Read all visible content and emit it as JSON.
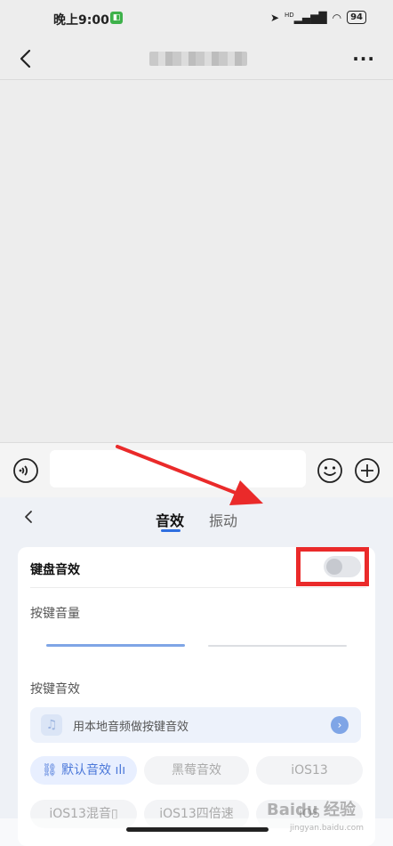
{
  "status_bar": {
    "time": "晚上9:00",
    "signal_label": "HD",
    "battery": "94"
  },
  "input_bar": {
    "placeholder": ""
  },
  "panel": {
    "tabs": [
      {
        "label": "音效",
        "active": true
      },
      {
        "label": "振动",
        "active": false
      }
    ],
    "keyboard_sound": {
      "label": "键盘音效",
      "enabled": false
    },
    "volume": {
      "label": "按键音量"
    },
    "key_sound": {
      "label": "按键音效"
    },
    "local_audio": {
      "label": "用本地音频做按键音效"
    },
    "sound_options": [
      {
        "label": "默认音效",
        "active": true
      },
      {
        "label": "黑莓音效",
        "active": false
      },
      {
        "label": "iOS13",
        "active": false
      },
      {
        "label": "iOS13混音",
        "active": false
      },
      {
        "label": "iOS13四倍速",
        "active": false
      },
      {
        "label": "iOS",
        "active": false
      }
    ]
  },
  "watermark": {
    "brand": "Baidu 经验",
    "url": "jingyan.baidu.com"
  },
  "colors": {
    "accent": "#2f6fe0",
    "annotation_red": "#ea2a2a"
  }
}
